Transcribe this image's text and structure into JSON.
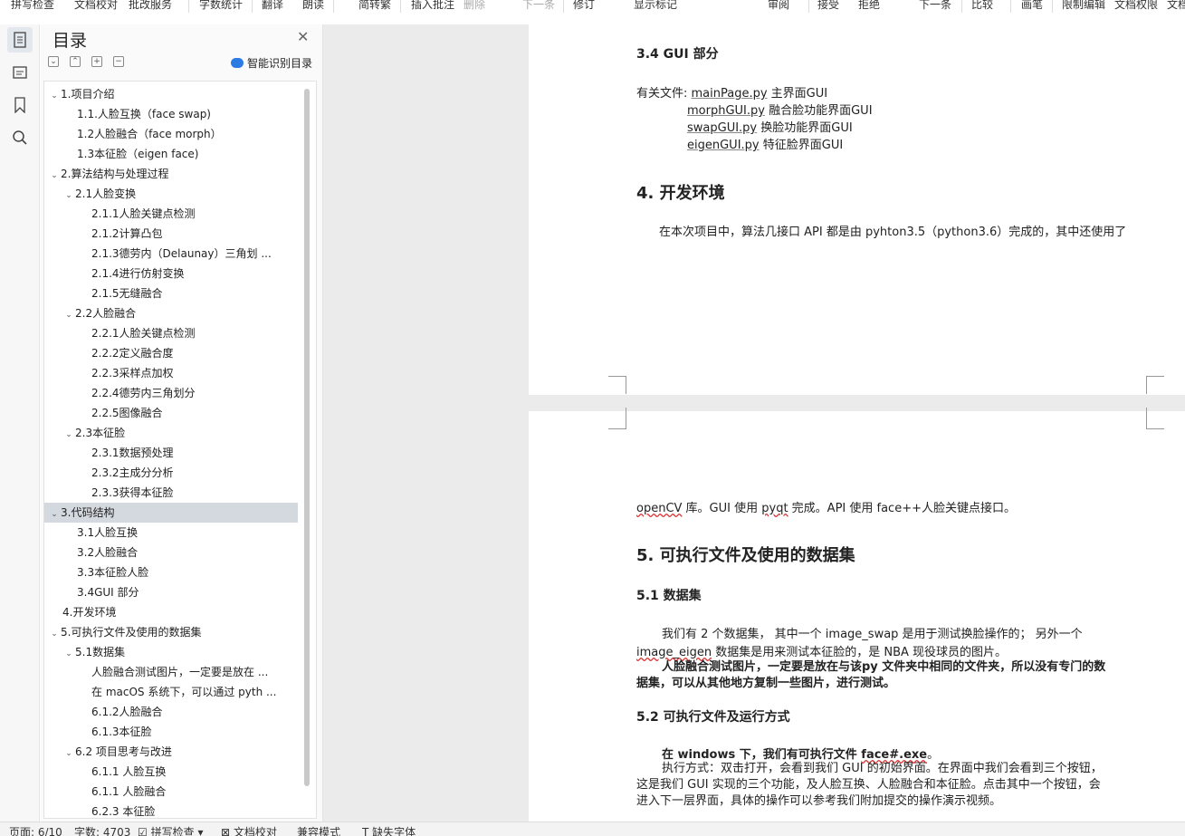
{
  "toolbar": {
    "items": [
      "拼写检查",
      "文档校对",
      "批改服务",
      "字数统计",
      "翻译",
      "朗读",
      "简转繁",
      "插入批注",
      "删除",
      "下一条",
      "修订",
      "显示标记",
      "审阅",
      "接受",
      "拒绝",
      "下一条",
      "比较",
      "画笔",
      "限制编辑",
      "文档权限",
      "文档"
    ]
  },
  "sidebar": {
    "title": "目录",
    "smart_label": "智能识别目录",
    "items": [
      {
        "label": "1.项目介绍",
        "level": 1,
        "arrow": "▾"
      },
      {
        "label": "1.1.人脸互换（face swap)",
        "level": 2,
        "arrow": ""
      },
      {
        "label": "1.2人脸融合（face morph）",
        "level": 2,
        "arrow": ""
      },
      {
        "label": "1.3本征脸（eigen face)",
        "level": 2,
        "arrow": ""
      },
      {
        "label": "2.算法结构与处理过程",
        "level": 1,
        "arrow": "▾"
      },
      {
        "label": "2.1人脸变换",
        "level": 2,
        "arrow": "▾"
      },
      {
        "label": "2.1.1人脸关键点检测",
        "level": 3,
        "arrow": ""
      },
      {
        "label": "2.1.2计算凸包",
        "level": 3,
        "arrow": ""
      },
      {
        "label": "2.1.3德劳内（Delaunay）三角划 ...",
        "level": 3,
        "arrow": ""
      },
      {
        "label": "2.1.4进行仿射变换",
        "level": 3,
        "arrow": ""
      },
      {
        "label": "2.1.5无缝融合",
        "level": 3,
        "arrow": ""
      },
      {
        "label": "2.2人脸融合",
        "level": 2,
        "arrow": "▾"
      },
      {
        "label": "2.2.1人脸关键点检测",
        "level": 3,
        "arrow": ""
      },
      {
        "label": "2.2.2定义融合度",
        "level": 3,
        "arrow": ""
      },
      {
        "label": "2.2.3采样点加权",
        "level": 3,
        "arrow": ""
      },
      {
        "label": "2.2.4德劳内三角划分",
        "level": 3,
        "arrow": ""
      },
      {
        "label": "2.2.5图像融合",
        "level": 3,
        "arrow": ""
      },
      {
        "label": "2.3本征脸",
        "level": 2,
        "arrow": "▾"
      },
      {
        "label": "2.3.1数据预处理",
        "level": 3,
        "arrow": ""
      },
      {
        "label": "2.3.2主成分分析",
        "level": 3,
        "arrow": ""
      },
      {
        "label": "2.3.3获得本征脸",
        "level": 3,
        "arrow": ""
      },
      {
        "label": "3.代码结构",
        "level": 1,
        "arrow": "▾",
        "selected": true
      },
      {
        "label": "3.1人脸互换",
        "level": 2,
        "arrow": ""
      },
      {
        "label": "3.2人脸融合",
        "level": 2,
        "arrow": ""
      },
      {
        "label": "3.3本征脸人脸",
        "level": 2,
        "arrow": ""
      },
      {
        "label": "3.4GUI 部分",
        "level": 2,
        "arrow": ""
      },
      {
        "label": "4.开发环境",
        "level": 1,
        "arrow": ""
      },
      {
        "label": "5.可执行文件及使用的数据集",
        "level": 1,
        "arrow": "▾"
      },
      {
        "label": "5.1数据集",
        "level": 2,
        "arrow": "▾"
      },
      {
        "label": "人脸融合测试图片，一定要是放在 ...",
        "level": 3,
        "arrow": ""
      },
      {
        "label": "在 macOS 系统下，可以通过 pyth ...",
        "level": 3,
        "arrow": ""
      },
      {
        "label": "6.1.2人脸融合",
        "level": 3,
        "arrow": ""
      },
      {
        "label": "6.1.3本征脸",
        "level": 3,
        "arrow": ""
      },
      {
        "label": "6.2 项目思考与改进",
        "level": 2,
        "arrow": "▾"
      },
      {
        "label": "6.1.1 人脸互换",
        "level": 3,
        "arrow": ""
      },
      {
        "label": "6.1.1 人脸融合",
        "level": 3,
        "arrow": ""
      },
      {
        "label": "6.2.3 本征脸",
        "level": 3,
        "arrow": ""
      }
    ]
  },
  "doc": {
    "p1": {
      "h_gui": "3.4 GUI 部分",
      "files_prefix": "有关文件: ",
      "files": [
        {
          "name": "mainPage.py",
          "desc": " 主界面GUI"
        },
        {
          "name": "morphGUI.py",
          "desc": " 融合脸功能界面GUI"
        },
        {
          "name": "swapGUI.py",
          "desc": " 换脸功能界面GUI"
        },
        {
          "name": "eigenGUI.py",
          "desc": " 特征脸界面GUI"
        }
      ],
      "h_env": "4.  开发环境",
      "env_text": "在本次项目中，算法几接口 API 都是由 pyhton3.5（python3.6）完成的，其中还使用了"
    },
    "p2": {
      "line1_a": "openCV",
      "line1_b": " 库。GUI 使用 ",
      "line1_c": "pyqt",
      "line1_d": " 完成。API 使用 face++人脸关键点接口。",
      "h5": "5.  可执行文件及使用的数据集",
      "h51": "5.1 数据集",
      "ds_1": "我们有 2 个数据集， 其中一个 image_swap 是用于测试换脸操作的； 另外一个",
      "ds_2a": "image_eigen",
      "ds_2b": " 数据集是用来测试本征脸的，是 NBA 现役球员的图片。",
      "bold_1": "人脸融合测试图片，一定要是放在与该py 文件夹中相同的文件夹，所以没有专门的数",
      "bold_2": "据集，可以从其他地方复制一些图片，进行测试。",
      "h52": "5.2 可执行文件及运行方式",
      "win_a": "在 windows 下，我们有可执行文件 ",
      "win_b": "face#.exe",
      "win_c": "。",
      "run_1": "执行方式：双击打开，会看到我们 GUI 的初始界面。在界面中我们会看到三个按钮，",
      "run_2": "这是我们 GUI 实现的三个功能，及人脸互换、人脸融合和本征脸。点击其中一个按钮，会",
      "run_3": "进入下一层界面，具体的操作可以参考我们附加提交的操作演示视频。"
    }
  },
  "statusbar": {
    "page": "页面: 6/10",
    "words": "字数: 4703",
    "spell": "拼写检查",
    "proof": "文档校对",
    "compat": "兼容模式",
    "font": "缺失字体"
  }
}
